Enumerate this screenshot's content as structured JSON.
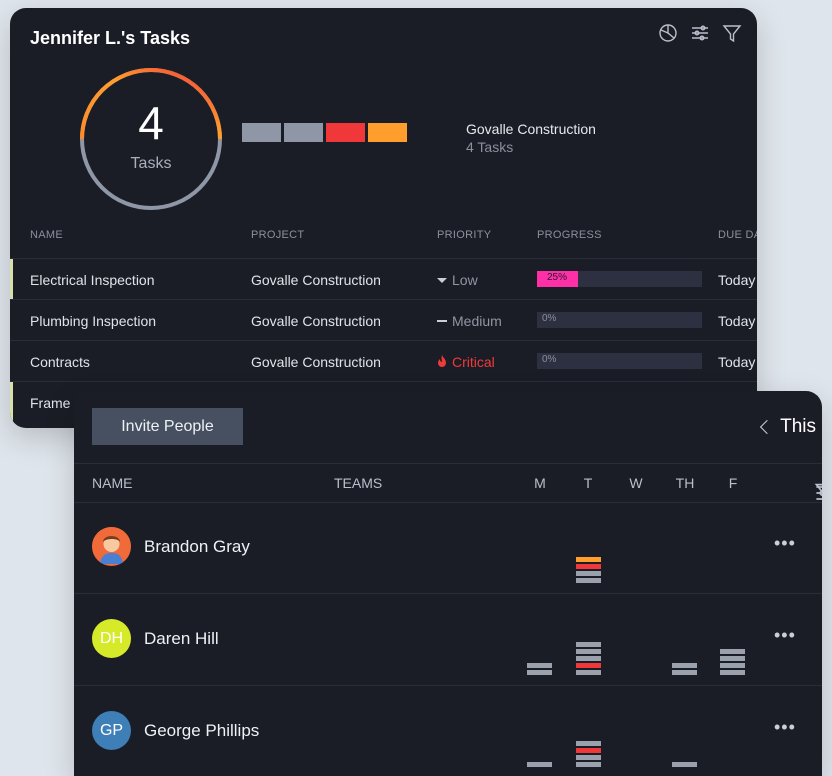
{
  "tasks_card": {
    "title": "Jennifer L.'s Tasks",
    "icons": [
      "pie-chart-icon",
      "sliders-icon",
      "filter-icon"
    ],
    "summary": {
      "count": "4",
      "count_label": "Tasks"
    },
    "status_segments": [
      {
        "status": "gray",
        "color": "#8f97a6"
      },
      {
        "status": "gray",
        "color": "#8f97a6"
      },
      {
        "status": "red",
        "color": "#f0383a"
      },
      {
        "status": "orange",
        "color": "#ff9e2c"
      }
    ],
    "project": {
      "name": "Govalle Construction",
      "count": "4 Tasks"
    },
    "columns": [
      "NAME",
      "PROJECT",
      "PRIORITY",
      "PROGRESS",
      "DUE DA"
    ],
    "rows": [
      {
        "name": "Electrical Inspection",
        "project": "Govalle Construction",
        "priority": "Low",
        "priority_level": "low",
        "progress": "25%",
        "progress_value": 0.25,
        "due": "Today",
        "accent": true
      },
      {
        "name": "Plumbing Inspection",
        "project": "Govalle Construction",
        "priority": "Medium",
        "priority_level": "medium",
        "progress": "0%",
        "progress_value": 0,
        "due": "Today",
        "accent": false
      },
      {
        "name": "Contracts",
        "project": "Govalle Construction",
        "priority": "Critical",
        "priority_level": "critical",
        "progress": "0%",
        "progress_value": 0,
        "due": "Today",
        "accent": false
      },
      {
        "name": "Frame",
        "project": "",
        "priority": "",
        "priority_level": "",
        "progress": "",
        "progress_value": 0,
        "due": "",
        "accent": true
      }
    ]
  },
  "team_card": {
    "invite_label": "Invite People",
    "week_label": "This",
    "columns": {
      "name": "NAME",
      "teams": "TEAMS"
    },
    "days": [
      "M",
      "T",
      "W",
      "TH",
      "F"
    ],
    "colors": {
      "gray": "#9aa1ad",
      "red": "#f0383a",
      "orange": "#ff9e2c"
    },
    "members": [
      {
        "name": "Brandon Gray",
        "initials": "",
        "avatar_color": "#f06a3a",
        "avatar_icon": "person-avatar-icon",
        "workload": {
          "M": [],
          "T": [
            "gray",
            "gray",
            "red",
            "orange"
          ],
          "W": [],
          "TH": [],
          "F": []
        }
      },
      {
        "name": "Daren Hill",
        "initials": "DH",
        "avatar_color": "#d6ea2a",
        "avatar_icon": "",
        "workload": {
          "M": [
            "gray",
            "gray"
          ],
          "T": [
            "gray",
            "red",
            "gray",
            "gray",
            "gray"
          ],
          "W": [],
          "TH": [
            "gray",
            "gray"
          ],
          "F": [
            "gray",
            "gray",
            "gray",
            "gray"
          ]
        }
      },
      {
        "name": "George Phillips",
        "initials": "GP",
        "avatar_color": "#3d7fb6",
        "avatar_icon": "",
        "workload": {
          "M": [
            "gray"
          ],
          "T": [
            "gray",
            "gray",
            "red",
            "gray"
          ],
          "W": [],
          "TH": [
            "gray"
          ],
          "F": []
        }
      }
    ],
    "more_label": "•••"
  }
}
